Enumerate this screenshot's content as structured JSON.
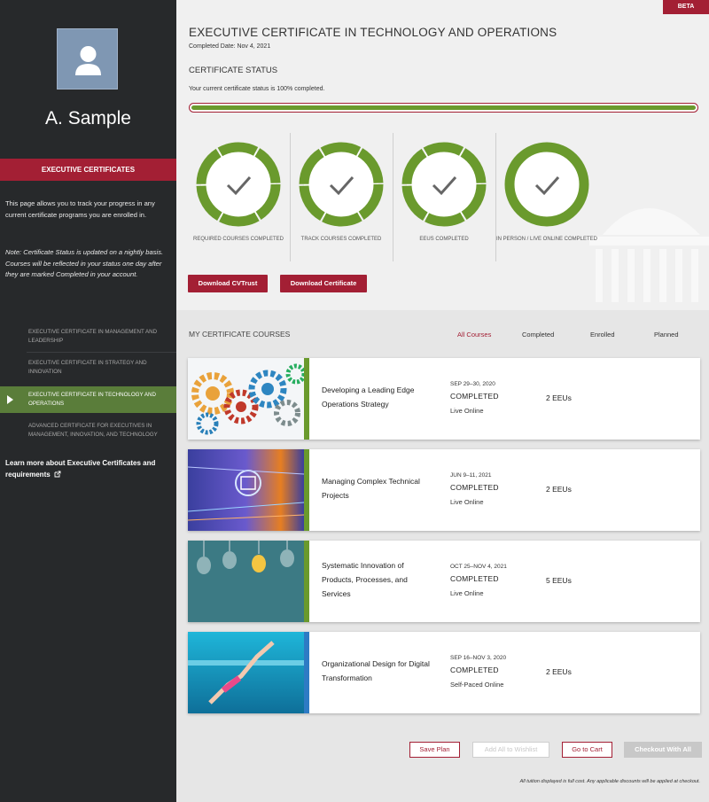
{
  "sidebar": {
    "user_name": "A. Sample",
    "section_title": "EXECUTIVE CERTIFICATES",
    "description": "This page allows you to track your progress in any current certificate programs you are enrolled in.",
    "note": "Note: Certificate Status is updated on a nightly basis. Courses will be reflected in your status one day after they are marked Completed in your account.",
    "items": [
      {
        "label": "EXECUTIVE CERTIFICATE IN MANAGEMENT AND LEADERSHIP",
        "active": false
      },
      {
        "label": "EXECUTIVE CERTIFICATE IN STRATEGY AND INNOVATION",
        "active": false
      },
      {
        "label": "EXECUTIVE CERTIFICATE IN TECHNOLOGY AND OPERATIONS",
        "active": true
      },
      {
        "label": "ADVANCED CERTIFICATE FOR EXECUTIVES IN MANAGEMENT, INNOVATION, AND TECHNOLOGY",
        "active": false
      }
    ],
    "learn_more": "Learn more about Executive Certificates and requirements"
  },
  "header": {
    "beta": "BETA",
    "title": "EXECUTIVE CERTIFICATE IN TECHNOLOGY AND OPERATIONS",
    "completed_date": "Completed Date:  Nov 4, 2021"
  },
  "status": {
    "heading": "CERTIFICATE STATUS",
    "text": "Your current certificate status is 100% completed.",
    "percent": 100,
    "stats": [
      {
        "label": "REQUIRED COURSES COMPLETED",
        "icon": "check-icon"
      },
      {
        "label": "TRACK COURSES COMPLETED",
        "icon": "check-icon"
      },
      {
        "label": "EEUS COMPLETED",
        "icon": "check-icon"
      },
      {
        "label": "IN PERSON / LIVE ONLINE COMPLETED",
        "icon": "check-icon"
      }
    ],
    "download_cvtrust": "Download CVTrust",
    "download_certificate": "Download Certificate"
  },
  "courses": {
    "heading": "MY CERTIFICATE COURSES",
    "filters": [
      "All Courses",
      "Completed",
      "Enrolled",
      "Planned"
    ],
    "active_filter": "All Courses",
    "list": [
      {
        "name": "Developing a Leading Edge Operations Strategy",
        "date": "SEP 29–30, 2020",
        "status": "COMPLETED",
        "format": "Live Online",
        "eeus": "2 EEUs",
        "bar_color": "#6a9a2d"
      },
      {
        "name": "Managing Complex Technical Projects",
        "date": "JUN 9–11, 2021",
        "status": "COMPLETED",
        "format": "Live Online",
        "eeus": "2 EEUs",
        "bar_color": "#6a9a2d"
      },
      {
        "name": "Systematic Innovation of Products, Processes, and Services",
        "date": "OCT 25–NOV 4, 2021",
        "status": "COMPLETED",
        "format": "Live Online",
        "eeus": "5 EEUs",
        "bar_color": "#6a9a2d"
      },
      {
        "name": "Organizational Design for Digital Transformation",
        "date": "SEP 16–NOV 3, 2020",
        "status": "COMPLETED",
        "format": "Self-Paced Online",
        "eeus": "2 EEUs",
        "bar_color": "#2e7bc4"
      }
    ]
  },
  "actions": {
    "save_plan": "Save Plan",
    "add_wishlist": "Add All to Wishlist",
    "go_to_cart": "Go to Cart",
    "checkout": "Checkout With All"
  },
  "disclaimer": "All tuition displayed is full cost. Any applicable discounts will be applied at checkout.",
  "colors": {
    "brand_red": "#a31f34",
    "green": "#6a9a2d",
    "blue": "#2e7bc4"
  }
}
